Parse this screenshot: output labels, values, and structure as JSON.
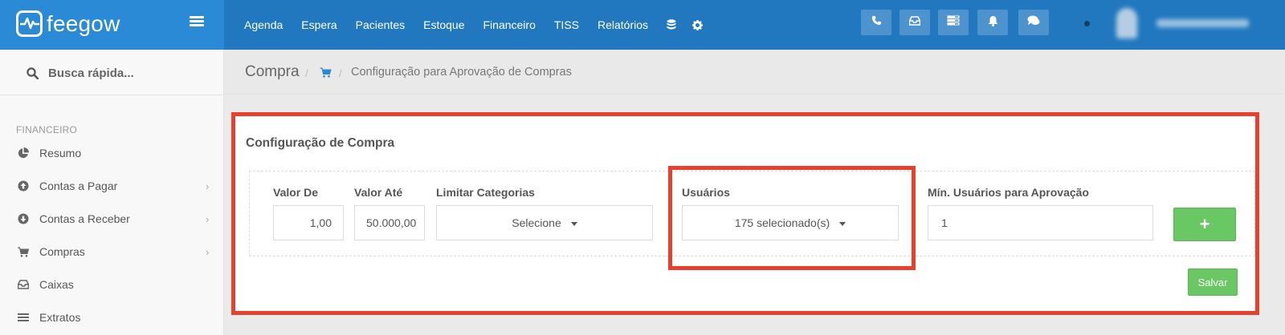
{
  "brand": {
    "name": "feegow"
  },
  "topnav": {
    "items": [
      "Agenda",
      "Espera",
      "Pacientes",
      "Estoque",
      "Financeiro",
      "TISS",
      "Relatórios"
    ],
    "icons": [
      "database-icon",
      "gear-icon"
    ]
  },
  "toolbar": {
    "buttons": [
      "phone-icon",
      "inbox-icon",
      "server-icon",
      "bell-icon",
      "chat-icon"
    ]
  },
  "search": {
    "placeholder": "Busca rápida..."
  },
  "sidebar": {
    "section": "FINANCEIRO",
    "items": [
      {
        "label": "Resumo",
        "icon": "pie-chart-icon",
        "has_submenu": false
      },
      {
        "label": "Contas a Pagar",
        "icon": "arrow-up-circle-icon",
        "has_submenu": true
      },
      {
        "label": "Contas a Receber",
        "icon": "arrow-down-circle-icon",
        "has_submenu": true
      },
      {
        "label": "Compras",
        "icon": "cart-icon",
        "has_submenu": true
      },
      {
        "label": "Caixas",
        "icon": "inbox-icon",
        "has_submenu": false
      },
      {
        "label": "Extratos",
        "icon": "list-icon",
        "has_submenu": false
      }
    ]
  },
  "breadcrumb": {
    "title": "Compra",
    "sep": "/",
    "page": "Configuração para Aprovação de Compras"
  },
  "panel": {
    "title": "Configuração de Compra",
    "fields": {
      "valor_de": {
        "label": "Valor De",
        "value": "1,00"
      },
      "valor_ate": {
        "label": "Valor Até",
        "value": "50.000,00"
      },
      "limitar_categorias": {
        "label": "Limitar Categorias",
        "value": "Selecione"
      },
      "usuarios": {
        "label": "Usuários",
        "value": "175 selecionado(s)"
      },
      "min_usuarios": {
        "label": "Mín. Usuários para Aprovação",
        "value": "1"
      }
    },
    "add_label": "+",
    "save_label": "Salvar"
  },
  "colors": {
    "topbar": "#2178bf",
    "brand_bg": "#2a8ad6",
    "highlight": "#e8402f",
    "success": "#69c764"
  }
}
